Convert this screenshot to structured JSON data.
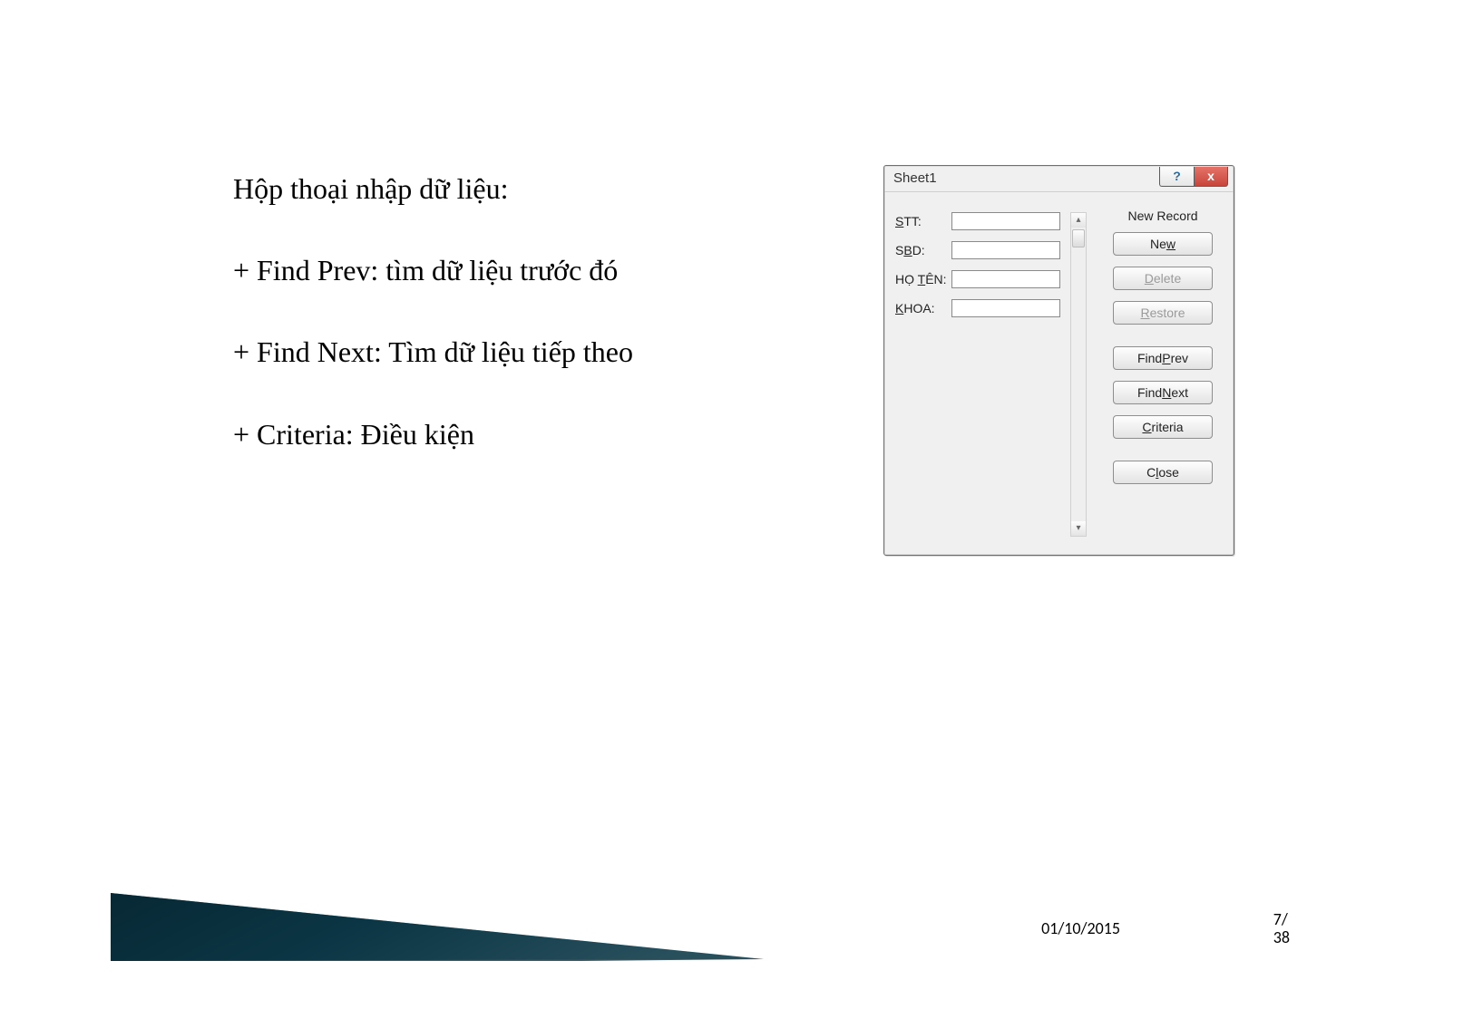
{
  "text": {
    "line1": "Hộp thoại nhập dữ liệu:",
    "line2": "+ Find Prev: tìm dữ liệu trước đó",
    "line3": "+ Find Next: Tìm dữ liệu tiếp theo",
    "line4": "+ Criteria: Điều kiện"
  },
  "dialog": {
    "title": "Sheet1",
    "help_glyph": "?",
    "close_glyph": "x",
    "status": "New Record",
    "fields": {
      "stt": {
        "u": "S",
        "rest": "TT:"
      },
      "sbd": {
        "u": "B",
        "pre": "S",
        "rest": "D:"
      },
      "hoten": {
        "pre": "HỌ ",
        "u": "T",
        "rest": "ÊN:"
      },
      "khoa": {
        "u": "K",
        "rest": "HOA:"
      }
    },
    "buttons": {
      "new": {
        "pre": "Ne",
        "u": "w",
        "rest": ""
      },
      "delete": {
        "pre": "",
        "u": "D",
        "rest": "elete"
      },
      "restore": {
        "pre": "",
        "u": "R",
        "rest": "estore"
      },
      "find_prev": {
        "pre": "Find ",
        "u": "P",
        "rest": "rev"
      },
      "find_next": {
        "pre": "Find ",
        "u": "N",
        "rest": "ext"
      },
      "criteria": {
        "pre": "",
        "u": "C",
        "rest": "riteria"
      },
      "close": {
        "pre": "C",
        "u": "l",
        "rest": "ose"
      }
    },
    "scroll": {
      "up": "▴",
      "down": "▾"
    }
  },
  "footer": {
    "date": "01/10/2015",
    "page_top": "7/",
    "page_bot": "38"
  }
}
